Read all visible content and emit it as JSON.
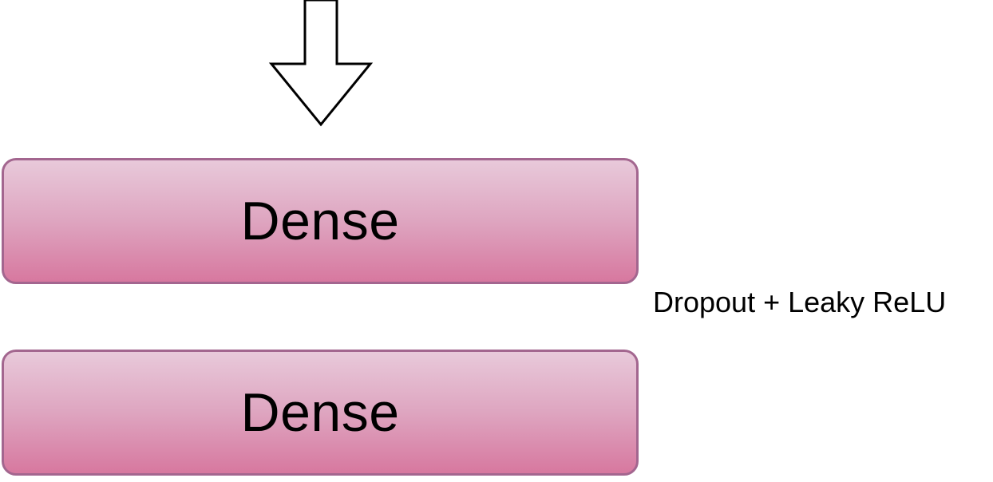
{
  "diagram": {
    "arrow": {
      "direction": "down",
      "fill": "#ffffff",
      "stroke": "#000000"
    },
    "blocks": [
      {
        "label": "Dense"
      },
      {
        "label": "Dense"
      }
    ],
    "annotation": "Dropout + Leaky ReLU",
    "colors": {
      "block_top": "#e8c9da",
      "block_bottom": "#d7789f",
      "block_border": "#a3668f"
    }
  }
}
